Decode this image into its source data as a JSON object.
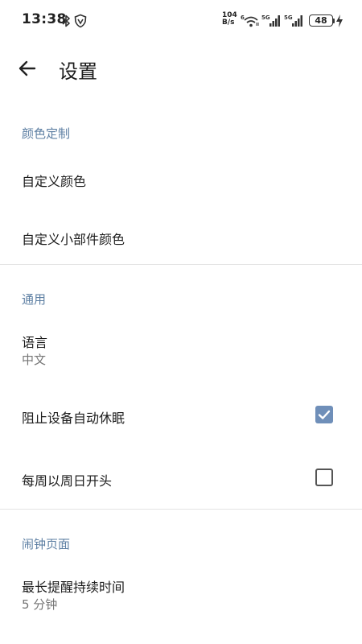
{
  "status_bar": {
    "time": "13:38",
    "net_speed_value": "104",
    "net_speed_unit": "B/s",
    "battery": "48"
  },
  "toolbar": {
    "title": "设置"
  },
  "sections": {
    "color": {
      "header": "颜色定制",
      "custom_color": "自定义颜色",
      "custom_widget_color": "自定义小部件颜色"
    },
    "general": {
      "header": "通用",
      "language_title": "语言",
      "language_value": "中文",
      "prevent_sleep": "阻止设备自动休眠",
      "prevent_sleep_checked": true,
      "week_start_sunday": "每周以周日开头",
      "week_start_sunday_checked": false
    },
    "alarm": {
      "header": "闹钟页面",
      "max_duration_title": "最长提醒持续时间",
      "max_duration_value": "5 分钟"
    }
  },
  "colors": {
    "accent": "#6f8fb9",
    "section_header": "#5d7fa3"
  },
  "icons": [
    "bluetooth-icon",
    "vpn-shield-icon",
    "wifi-icon",
    "signal-5g-icon",
    "charging-bolt-icon",
    "back-arrow-icon",
    "check-icon"
  ]
}
